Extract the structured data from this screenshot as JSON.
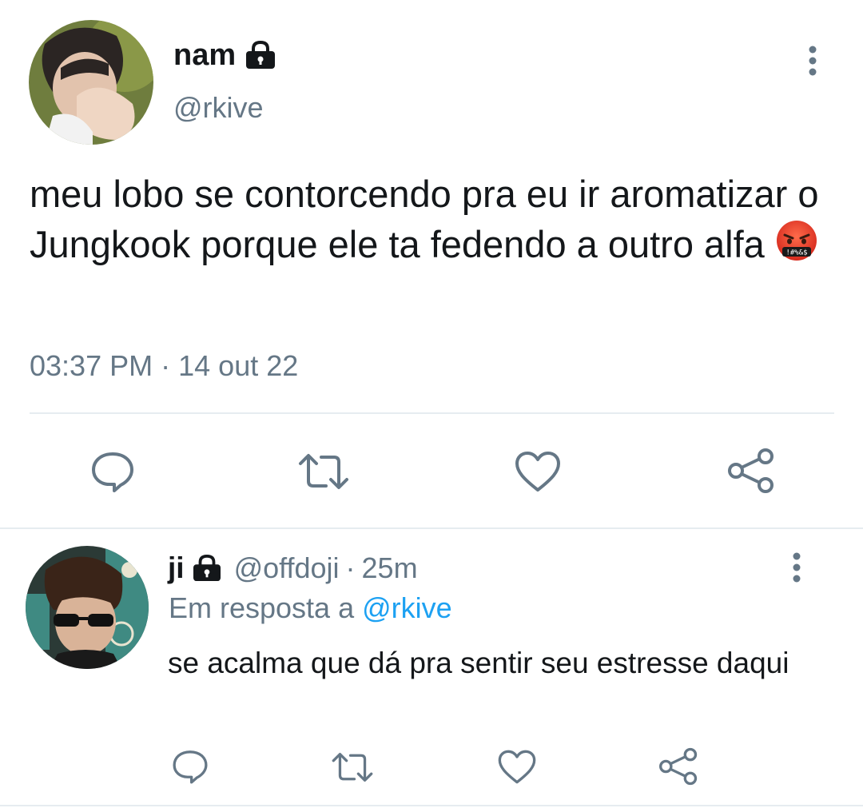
{
  "main_tweet": {
    "display_name": "nam",
    "handle": "@rkive",
    "text": "meu lobo se contorcendo pra eu ir aromatizar o Jungkook porque ele ta fedendo a outro alfa",
    "emoji": "face-with-symbols-on-mouth",
    "time": "03:37 PM",
    "separator": "·",
    "date": "14 out 22",
    "icons": [
      "lock-icon",
      "more-vertical-icon",
      "reply-icon",
      "retweet-icon",
      "like-icon",
      "share-icon"
    ]
  },
  "reply_tweet": {
    "display_name": "ji",
    "handle": "@offdoji",
    "separator": "·",
    "age": "25m",
    "reply_prefix": "Em resposta a",
    "reply_mention": "@rkive",
    "text": "se acalma que dá pra sentir seu estresse daqui",
    "icons": [
      "lock-icon",
      "more-vertical-icon",
      "reply-icon",
      "retweet-icon",
      "like-icon",
      "share-icon"
    ]
  },
  "colors": {
    "text": "#14171a",
    "secondary": "#657786",
    "link": "#1da1f2",
    "divider": "#e6ecf0"
  }
}
